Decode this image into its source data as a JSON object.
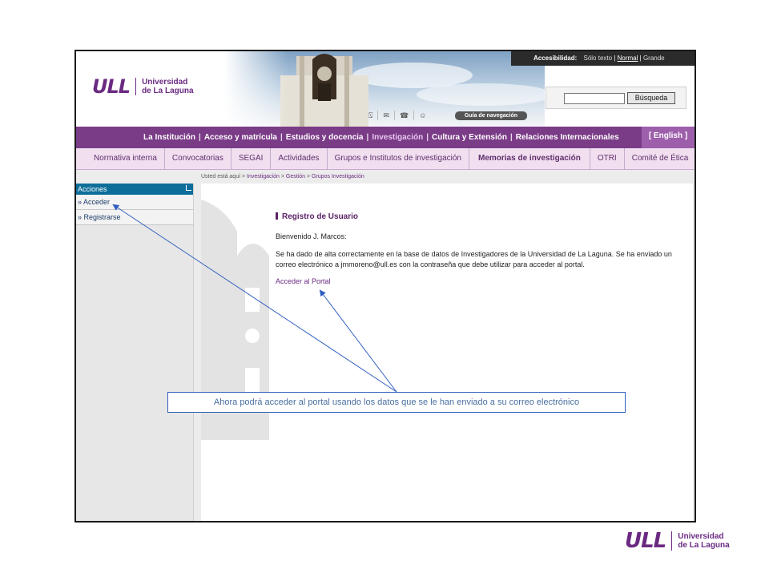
{
  "header": {
    "logo_mark": "ULL",
    "logo_line1": "Universidad",
    "logo_line2": "de La Laguna",
    "accessibility_label": "Accesibilidad:",
    "accessibility_options": [
      "Sólo texto",
      "Normal",
      "Grande"
    ],
    "search_button": "Búsqueda",
    "search_value": "",
    "guide_button": "Guía de navegación",
    "icon_names": [
      "sitemap-icon",
      "mail-icon",
      "phone-icon",
      "users-icon"
    ]
  },
  "mainnav": {
    "items": [
      "La Institución",
      "Acceso y matrícula",
      "Estudios y docencia",
      "Investigación",
      "Cultura y Extensión",
      "Relaciones Internacionales"
    ],
    "active": "Investigación",
    "language": "[ English ]"
  },
  "subnav": {
    "items": [
      "Normativa interna",
      "Convocatorias",
      "SEGAI",
      "Actividades",
      "Grupos e Institutos de investigación",
      "Memorias de investigación",
      "OTRI",
      "Comité de Ética"
    ],
    "bold_item": "Memorias de investigación"
  },
  "breadcrumb": {
    "prefix": "Usted está aquí >",
    "links": [
      "Investigación",
      "Gestión",
      "Grupos Investigación"
    ]
  },
  "sidebar": {
    "title": "Acciones",
    "items": [
      "» Acceder",
      "» Registrarse"
    ]
  },
  "content": {
    "title": "Registro de Usuario",
    "welcome": "Bienvenido J. Marcos:",
    "message": "Se ha dado de alta correctamente en la base de datos de Investigadores de la Universidad de La Laguna. Se ha enviado un correo electrónico a jmmoreno@ull.es con la contraseña que debe utilizar para acceder al portal.",
    "portal_link": "Acceder al Portal"
  },
  "callout": {
    "text": "Ahora podrá acceder al portal usando los datos que se le han enviado a su correo electrónico"
  },
  "footer": {
    "logo_mark": "ULL",
    "logo_line1": "Universidad",
    "logo_line2": "de La Laguna"
  },
  "colors": {
    "brand_purple": "#7a3b87",
    "sidebar_header": "#0e6e9a",
    "callout_border": "#2f5fbf"
  }
}
